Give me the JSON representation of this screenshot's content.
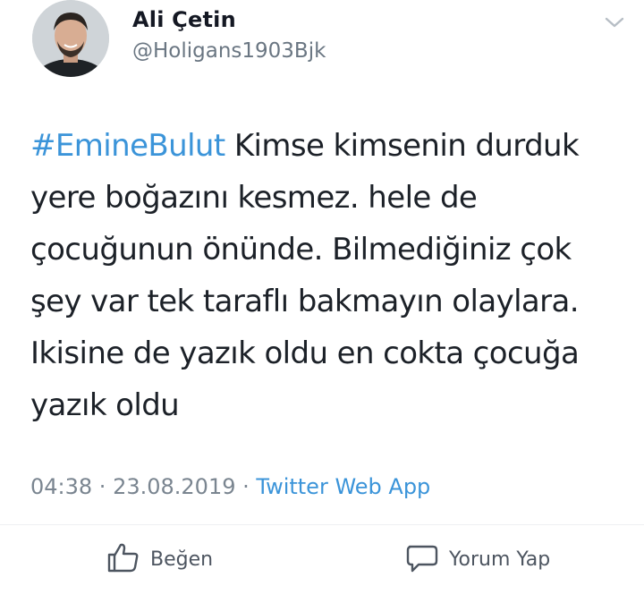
{
  "user": {
    "display_name": "Ali Çetin",
    "handle": "@Holigans1903Bjk"
  },
  "tweet": {
    "hashtag": "#EmineBulut",
    "body": " Kimse kimsenin durduk yere boğazını kesmez. hele de çocuğunun önünde. Bilmediğiniz çok şey var tek taraflı bakmayın olaylara. Ikisine de yazık oldu en cokta çocuğa yazık oldu"
  },
  "meta": {
    "time": "04:38",
    "separator": " · ",
    "date": "23.08.2019",
    "source": "Twitter Web App"
  },
  "actions": {
    "like_label": "Beğen",
    "reply_label": "Yorum Yap"
  },
  "icons": {
    "menu": "chevron-down-icon",
    "like": "thumbs-up-icon",
    "reply": "speech-bubble-icon"
  },
  "colors": {
    "link": "#3b94d9",
    "text": "#1c2128",
    "muted": "#7a8590"
  }
}
